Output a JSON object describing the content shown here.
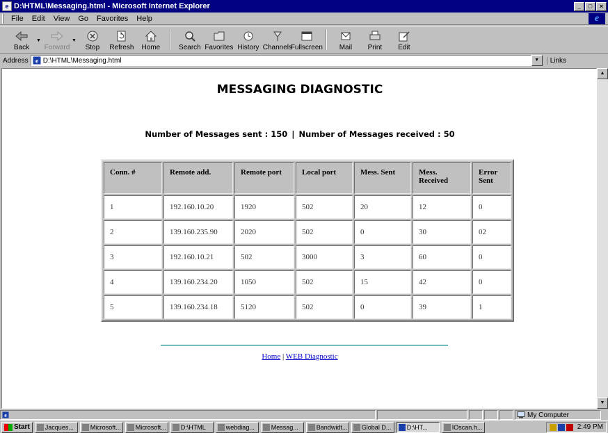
{
  "window": {
    "title": "D:\\HTML\\Messaging.html - Microsoft Internet Explorer",
    "buttons": [
      "_",
      "□",
      "×"
    ]
  },
  "menu": [
    "File",
    "Edit",
    "View",
    "Go",
    "Favorites",
    "Help"
  ],
  "toolbar": {
    "buttons": [
      {
        "label": "Back",
        "icon": "back-arrow-icon"
      },
      {
        "label": "Forward",
        "icon": "forward-arrow-icon",
        "disabled": true
      },
      {
        "label": "Stop",
        "icon": "stop-icon"
      },
      {
        "label": "Refresh",
        "icon": "refresh-icon"
      },
      {
        "label": "Home",
        "icon": "home-icon"
      },
      {
        "label": "Search",
        "icon": "search-icon"
      },
      {
        "label": "Favorites",
        "icon": "favorites-icon"
      },
      {
        "label": "History",
        "icon": "history-icon"
      },
      {
        "label": "Channels",
        "icon": "channels-icon"
      },
      {
        "label": "Fullscreen",
        "icon": "fullscreen-icon"
      },
      {
        "label": "Mail",
        "icon": "mail-icon"
      },
      {
        "label": "Print",
        "icon": "print-icon"
      },
      {
        "label": "Edit",
        "icon": "edit-icon"
      }
    ]
  },
  "address": {
    "label": "Address",
    "value": "D:\\HTML\\Messaging.html",
    "links_label": "Links"
  },
  "page": {
    "title": "MESSAGING DIAGNOSTIC",
    "summary_sent": "Number of Messages sent : 150",
    "summary_sep": "|",
    "summary_received": "Number of Messages received : 50",
    "table": {
      "headers": [
        "Conn. #",
        "Remote add.",
        "Remote port",
        "Local port",
        "Mess. Sent",
        "Mess. Received",
        "Error Sent"
      ],
      "rows": [
        [
          "1",
          "192.160.10.20",
          "1920",
          "502",
          "20",
          "12",
          "0"
        ],
        [
          "2",
          "139.160.235.90",
          "2020",
          "502",
          "0",
          "30",
          "02"
        ],
        [
          "3",
          "192.160.10.21",
          "502",
          "3000",
          "3",
          "60",
          "0"
        ],
        [
          "4",
          "139.160.234.20",
          "1050",
          "502",
          "15",
          "42",
          "0"
        ],
        [
          "5",
          "139.160.234.18",
          "5120",
          "502",
          "0",
          "39",
          "1"
        ]
      ]
    },
    "links": {
      "home": "Home",
      "sep": " | ",
      "web_diagnostic": "WEB Diagnostic"
    }
  },
  "status": {
    "zone": "My Computer"
  },
  "taskbar": {
    "start": "Start",
    "tasks": [
      "Jacques...",
      "Microsoft...",
      "Microsoft...",
      "D:\\HTML",
      "webdiag...",
      "Messag...",
      "Bandwidt...",
      "Global D...",
      "D:\\HT...",
      "IOscan.h..."
    ],
    "active_index": 8,
    "clock": "2:49 PM"
  }
}
